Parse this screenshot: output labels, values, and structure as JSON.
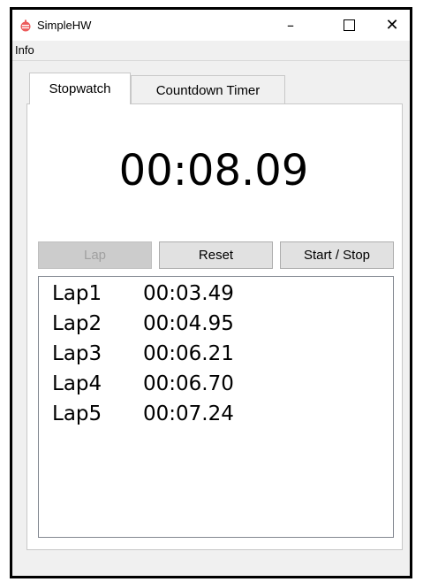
{
  "window": {
    "title": "SimpleHW",
    "minimize_glyph": "–",
    "close_glyph": "✕",
    "app_icon": "app-icon",
    "accent": "#ec5b5b"
  },
  "menubar": {
    "info": "Info"
  },
  "tabs": [
    {
      "label": "Stopwatch",
      "selected": true
    },
    {
      "label": "Countdown Timer",
      "selected": false
    }
  ],
  "stopwatch": {
    "time": "00:08.09",
    "buttons": {
      "lap": "Lap",
      "reset": "Reset",
      "start_stop": "Start / Stop"
    },
    "laps": [
      {
        "name": "Lap1",
        "time": "00:03.49"
      },
      {
        "name": "Lap2",
        "time": "00:04.95"
      },
      {
        "name": "Lap3",
        "time": "00:06.21"
      },
      {
        "name": "Lap4",
        "time": "00:06.70"
      },
      {
        "name": "Lap5",
        "time": "00:07.24"
      }
    ]
  }
}
